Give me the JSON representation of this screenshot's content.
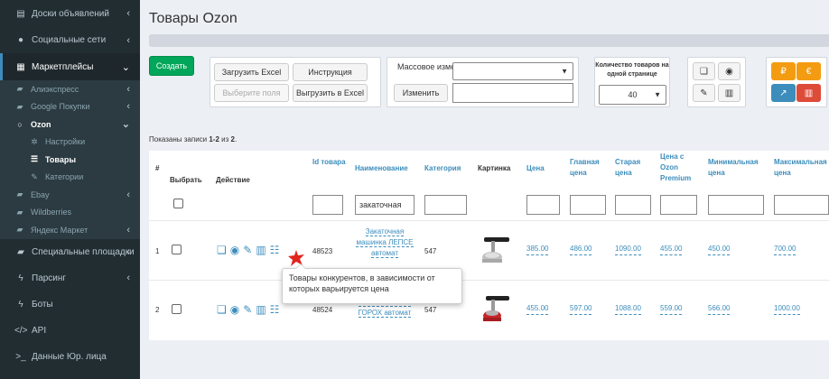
{
  "sidebar": {
    "items": [
      {
        "label": "Доски объявлений",
        "icon": "clipboard-icon"
      },
      {
        "label": "Социальные сети",
        "icon": "user-icon"
      },
      {
        "label": "Маркетплейсы",
        "icon": "grid-icon"
      },
      {
        "label": "Алиэкспресс",
        "icon": "truck-icon"
      },
      {
        "label": "Google Покупки",
        "icon": "truck-icon"
      },
      {
        "label": "Ozon",
        "icon": "circle-icon"
      },
      {
        "label": "Настройки",
        "icon": "gear-icon"
      },
      {
        "label": "Товары",
        "icon": "list-icon"
      },
      {
        "label": "Категории",
        "icon": "tag-icon"
      },
      {
        "label": "Ebay",
        "icon": "truck-icon"
      },
      {
        "label": "Wildberries",
        "icon": "truck-icon"
      },
      {
        "label": "Яндекс Маркет",
        "icon": "truck-icon"
      },
      {
        "label": "Специальные площадки",
        "icon": "truck-icon"
      },
      {
        "label": "Парсинг",
        "icon": "bolt-icon"
      },
      {
        "label": "Боты",
        "icon": "bolt-icon"
      },
      {
        "label": "API",
        "icon": "code-icon"
      },
      {
        "label": "Данные Юр. лица",
        "icon": "terminal-icon"
      },
      {
        "label": "",
        "icon": "globe-icon"
      }
    ]
  },
  "page": {
    "title": "Товары Ozon",
    "create_label": "Создать"
  },
  "toolbar": {
    "upload_excel": "Загрузить Excel",
    "instruction": "Инструкция",
    "choose_fields": "Выберите поля",
    "export_excel": "Выгрузить в Excel",
    "mass_change_label": "Массовое изменение:",
    "change_button": "Изменить",
    "qty_label": "Количество товаров на одной странице",
    "qty_value": "40"
  },
  "summary": {
    "prefix": "Показаны записи ",
    "range": "1-2",
    "middle": " из ",
    "total": "2",
    "suffix": "."
  },
  "table": {
    "headers": {
      "num": "#",
      "select": "Выбрать",
      "action": "Действие",
      "id": "Id товара",
      "name": "Наименование",
      "category": "Категория",
      "image": "Картинка",
      "price": "Цена",
      "main_price": "Главная цена",
      "old_price": "Старая цена",
      "ozon_price": "Цена с Ozon Premium",
      "min_price": "Минимальная цена",
      "max_price": "Максимальная цена"
    },
    "filter_name": "закаточная",
    "rows": [
      {
        "num": "1",
        "id": "48523",
        "name": "Закаточная машинка ЛЕПСЕ автомат",
        "category": "547",
        "price": "385.00",
        "main_price": "486.00",
        "old_price": "1090.00",
        "ozon_price": "455.00",
        "min_price": "450.00",
        "max_price": "700.00"
      },
      {
        "num": "2",
        "id": "48524",
        "name": "Закаточная машинка Лепсе ГОРОХ автомат",
        "category": "547",
        "price": "455.00",
        "main_price": "597.00",
        "old_price": "1088.00",
        "ozon_price": "559.00",
        "min_price": "566.00",
        "max_price": "1000.00"
      }
    ]
  },
  "tooltip": {
    "text": "Товары конкурентов, в зависимости от которых варьируется цена"
  },
  "colors": {
    "sidebar_bg": "#222d32",
    "accent": "#3c8dbc",
    "create": "#00a65a",
    "orange": "#f39c12",
    "blue": "#3c8dbc",
    "red": "#dd4b39"
  }
}
